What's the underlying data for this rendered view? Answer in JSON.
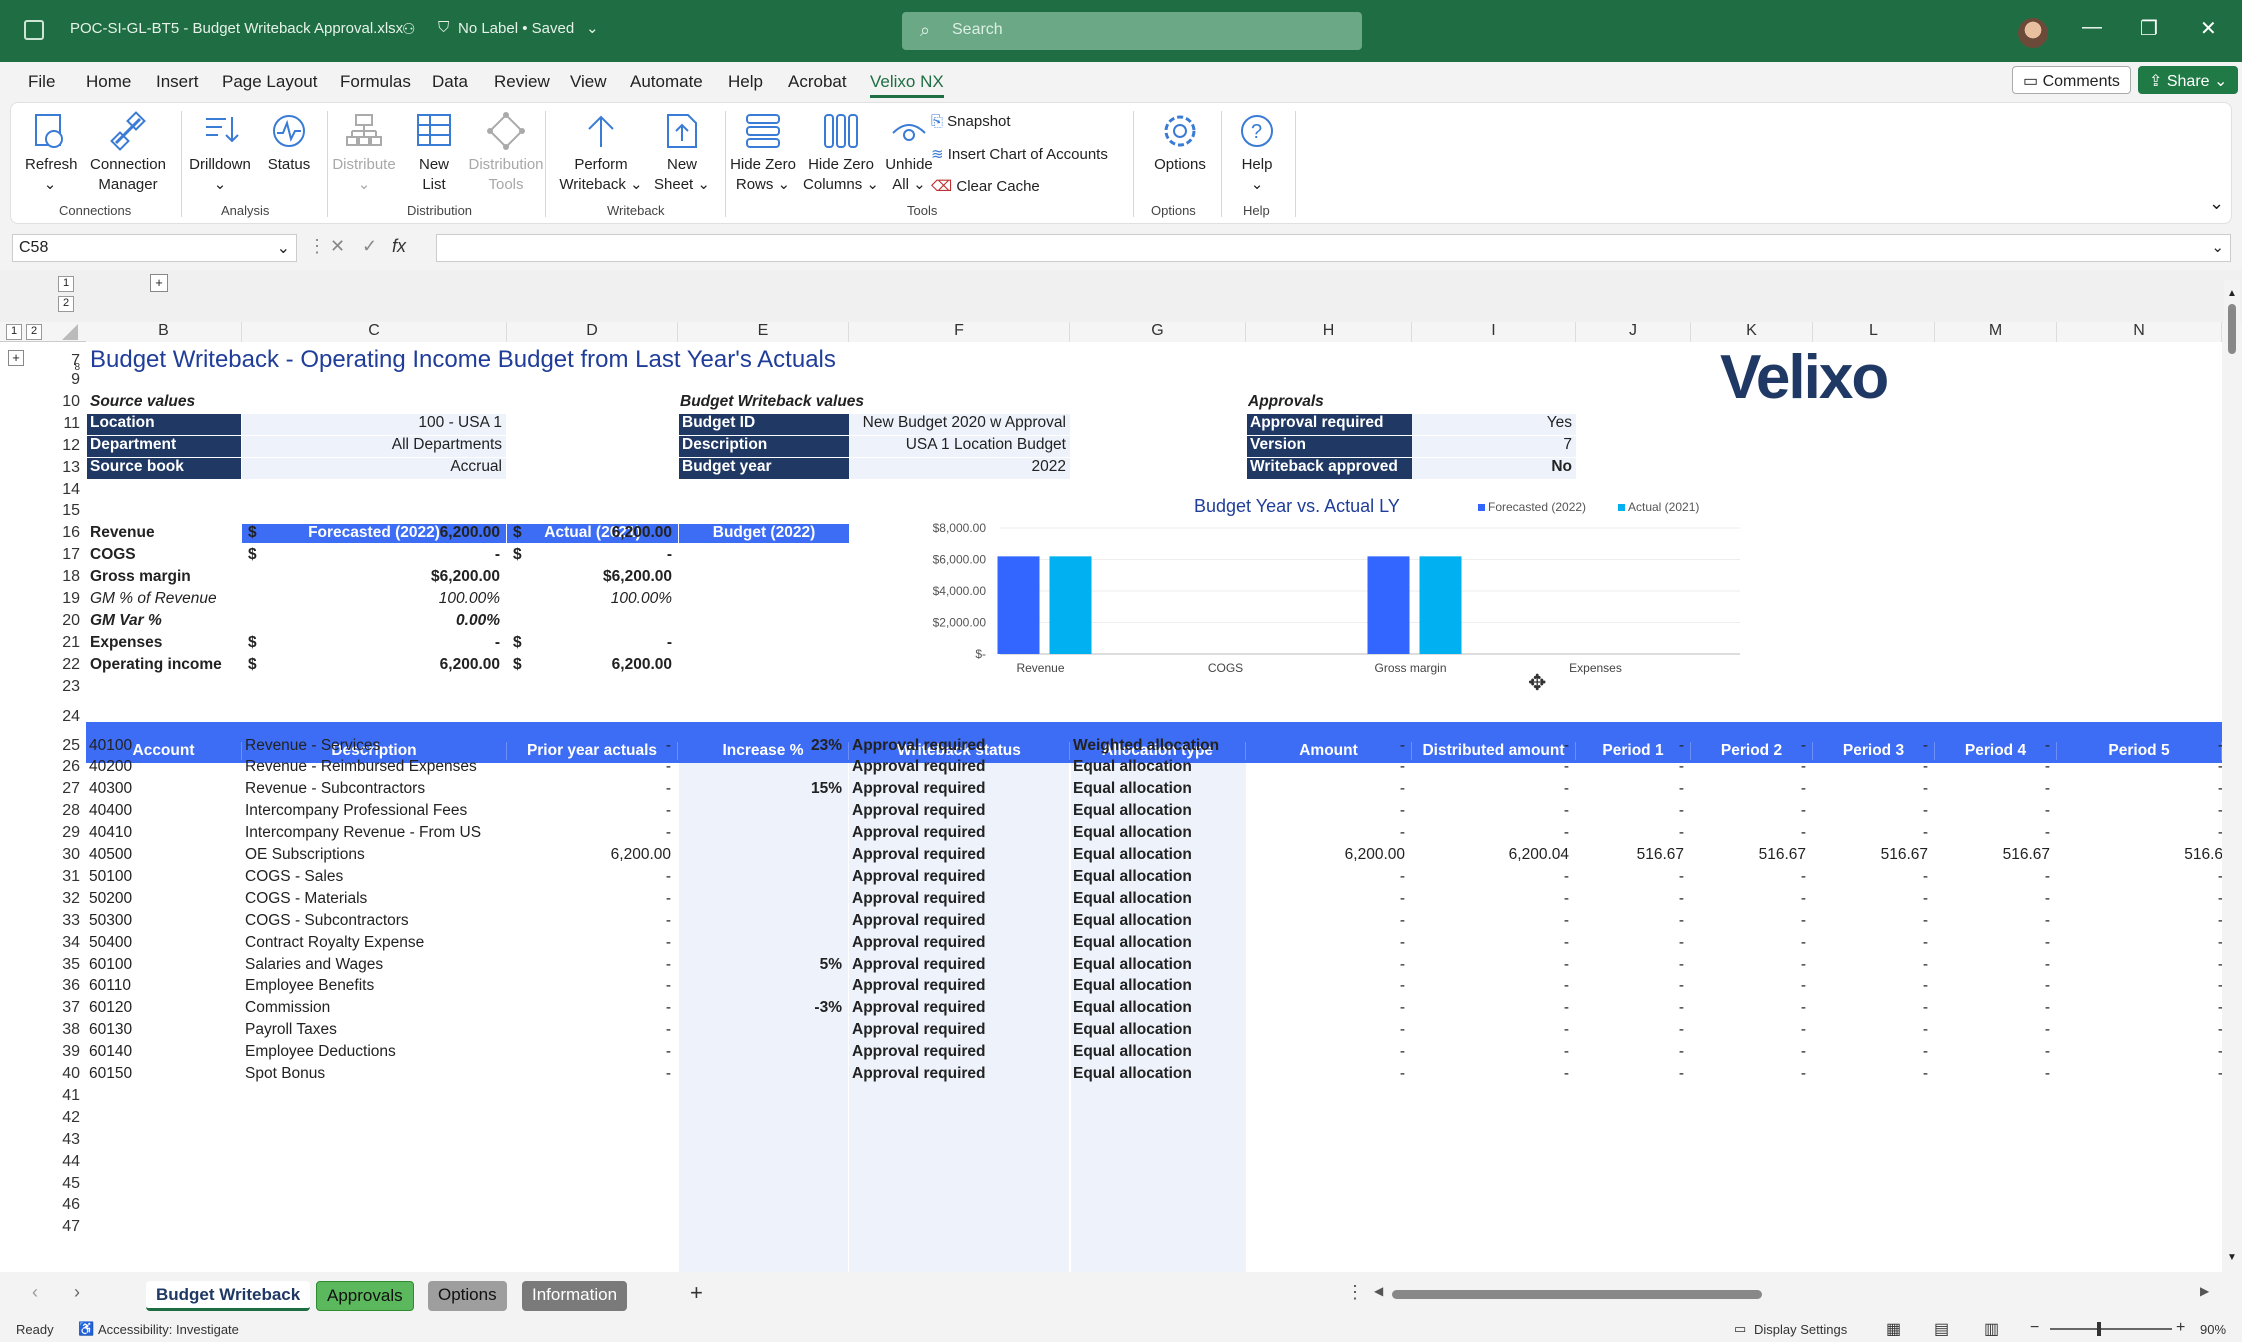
{
  "titlebar": {
    "file_name": "POC-SI-GL-BT5 - Budget Writeback Approval.xlsx",
    "label_status": "No Label • Saved",
    "search_placeholder": "Search"
  },
  "menu": {
    "items": [
      "File",
      "Home",
      "Insert",
      "Page Layout",
      "Formulas",
      "Data",
      "Review",
      "View",
      "Automate",
      "Help",
      "Acrobat",
      "Velixo NX"
    ],
    "active": "Velixo NX",
    "comments": "Comments",
    "share": "Share"
  },
  "ribbon": {
    "refresh": "Refresh",
    "connection_manager": [
      "Connection",
      "Manager"
    ],
    "drilldown": "Drilldown",
    "status": "Status",
    "distribute": "Distribute",
    "new_list": [
      "New",
      "List"
    ],
    "distribution_tools": [
      "Distribution",
      "Tools"
    ],
    "perform_writeback": [
      "Perform",
      "Writeback"
    ],
    "new_sheet": [
      "New",
      "Sheet"
    ],
    "hide_zero_rows": [
      "Hide Zero",
      "Rows"
    ],
    "hide_zero_columns": [
      "Hide Zero",
      "Columns"
    ],
    "unhide_all": [
      "Unhide",
      "All"
    ],
    "snapshot": "Snapshot",
    "insert_coa": "Insert Chart of Accounts",
    "clear_cache": "Clear Cache",
    "options": "Options",
    "help": "Help",
    "groups": [
      "Connections",
      "Analysis",
      "Distribution",
      "Writeback",
      "Tools",
      "Options",
      "Help"
    ]
  },
  "formula_bar": {
    "name_box": "C58",
    "fx": "fx",
    "formula": ""
  },
  "columns": [
    "B",
    "C",
    "D",
    "E",
    "F",
    "G",
    "H",
    "I",
    "J",
    "K",
    "L",
    "M",
    "N"
  ],
  "outline_levels": [
    "1",
    "2"
  ],
  "sheet": {
    "title": "Budget Writeback - Operating Income Budget from Last Year's Actuals",
    "logo": "Velixo",
    "source": {
      "heading": "Source values",
      "rows": [
        {
          "label": "Location",
          "value": "100 - USA 1"
        },
        {
          "label": "Department",
          "value": "All Departments"
        },
        {
          "label": "Source book",
          "value": "Accrual"
        }
      ]
    },
    "writeback": {
      "heading": "Budget Writeback values",
      "rows": [
        {
          "label": "Budget ID",
          "value": "New Budget 2020 w Approval"
        },
        {
          "label": "Description",
          "value": "USA 1 Location Budget"
        },
        {
          "label": "Budget year",
          "value": "2022"
        }
      ]
    },
    "approvals": {
      "heading": "Approvals",
      "rows": [
        {
          "label": "Approval required",
          "value": "Yes"
        },
        {
          "label": "Version",
          "value": "7"
        },
        {
          "label": "Writeback approved",
          "value": "No"
        }
      ]
    },
    "summary": {
      "headers": [
        "Forecasted (2022)",
        "Actual (2021)",
        "Budget (2022)"
      ],
      "rows": [
        {
          "label": "Revenue",
          "d1": "$",
          "v1": "6,200.00",
          "d2": "$",
          "v2": "6,200.00",
          "style": "b"
        },
        {
          "label": "COGS",
          "d1": "$",
          "v1": "-",
          "d2": "$",
          "v2": "-",
          "style": "b"
        },
        {
          "label": "Gross margin",
          "d1": "",
          "v1": "$6,200.00",
          "d2": "",
          "v2": "$6,200.00",
          "style": "b"
        },
        {
          "label": "GM % of Revenue",
          "d1": "",
          "v1": "100.00%",
          "d2": "",
          "v2": "100.00%",
          "style": "i"
        },
        {
          "label": "GM Var %",
          "d1": "",
          "v1": "0.00%",
          "d2": "",
          "v2": "",
          "style": "bi"
        },
        {
          "label": "Expenses",
          "d1": "$",
          "v1": "-",
          "d2": "$",
          "v2": "-",
          "style": "b"
        },
        {
          "label": "Operating income",
          "d1": "$",
          "v1": "6,200.00",
          "d2": "$",
          "v2": "6,200.00",
          "style": "b"
        }
      ]
    },
    "table": {
      "headers": [
        "Account",
        "Description",
        "Prior year actuals",
        "Increase %",
        "Writeback status",
        "Allocation type",
        "Amount",
        "Distributed amount",
        "Period 1",
        "Period 2",
        "Period 3",
        "Period 4",
        "Period 5"
      ],
      "rows": [
        [
          "40100",
          "Revenue - Services",
          "-",
          "23%",
          "Approval required",
          "Weighted allocation",
          "-",
          "-",
          "-",
          "-",
          "-",
          "-",
          "-"
        ],
        [
          "40200",
          "Revenue - Reimbursed Expenses",
          "-",
          "",
          "Approval required",
          "Equal allocation",
          "-",
          "-",
          "-",
          "-",
          "-",
          "-",
          "-"
        ],
        [
          "40300",
          "Revenue - Subcontractors",
          "-",
          "15%",
          "Approval required",
          "Equal allocation",
          "-",
          "-",
          "-",
          "-",
          "-",
          "-",
          "-"
        ],
        [
          "40400",
          "Intercompany Professional Fees",
          "-",
          "",
          "Approval required",
          "Equal allocation",
          "-",
          "-",
          "-",
          "-",
          "-",
          "-",
          "-"
        ],
        [
          "40410",
          "Intercompany Revenue - From US",
          "-",
          "",
          "Approval required",
          "Equal allocation",
          "-",
          "-",
          "-",
          "-",
          "-",
          "-",
          "-"
        ],
        [
          "40500",
          "OE Subscriptions",
          "6,200.00",
          "",
          "Approval required",
          "Equal allocation",
          "6,200.00",
          "6,200.04",
          "516.67",
          "516.67",
          "516.67",
          "516.67",
          "516.6"
        ],
        [
          "50100",
          "COGS - Sales",
          "-",
          "",
          "Approval required",
          "Equal allocation",
          "-",
          "-",
          "-",
          "-",
          "-",
          "-",
          "-"
        ],
        [
          "50200",
          "COGS - Materials",
          "-",
          "",
          "Approval required",
          "Equal allocation",
          "-",
          "-",
          "-",
          "-",
          "-",
          "-",
          "-"
        ],
        [
          "50300",
          "COGS - Subcontractors",
          "-",
          "",
          "Approval required",
          "Equal allocation",
          "-",
          "-",
          "-",
          "-",
          "-",
          "-",
          "-"
        ],
        [
          "50400",
          "Contract Royalty Expense",
          "-",
          "",
          "Approval required",
          "Equal allocation",
          "-",
          "-",
          "-",
          "-",
          "-",
          "-",
          "-"
        ],
        [
          "60100",
          "Salaries and Wages",
          "-",
          "5%",
          "Approval required",
          "Equal allocation",
          "-",
          "-",
          "-",
          "-",
          "-",
          "-",
          "-"
        ],
        [
          "60110",
          "Employee Benefits",
          "-",
          "",
          "Approval required",
          "Equal allocation",
          "-",
          "-",
          "-",
          "-",
          "-",
          "-",
          "-"
        ],
        [
          "60120",
          "Commission",
          "-",
          "-3%",
          "Approval required",
          "Equal allocation",
          "-",
          "-",
          "-",
          "-",
          "-",
          "-",
          "-"
        ],
        [
          "60130",
          "Payroll Taxes",
          "-",
          "",
          "Approval required",
          "Equal allocation",
          "-",
          "-",
          "-",
          "-",
          "-",
          "-",
          "-"
        ],
        [
          "60140",
          "Employee Deductions",
          "-",
          "",
          "Approval required",
          "Equal allocation",
          "-",
          "-",
          "-",
          "-",
          "-",
          "-",
          "-"
        ],
        [
          "60150",
          "Spot Bonus",
          "-",
          "",
          "Approval required",
          "Equal allocation",
          "-",
          "-",
          "-",
          "-",
          "-",
          "-",
          "-"
        ]
      ]
    },
    "row_numbers": [
      "7",
      "8",
      "9",
      "10",
      "11",
      "12",
      "13",
      "14",
      "15",
      "16",
      "17",
      "18",
      "19",
      "20",
      "21",
      "22",
      "23",
      "24",
      "25",
      "26",
      "27",
      "28",
      "29",
      "30",
      "31",
      "32",
      "33",
      "34",
      "35",
      "36",
      "37",
      "38",
      "39",
      "40",
      "41",
      "42",
      "43",
      "44",
      "45",
      "46",
      "47"
    ]
  },
  "chart_data": {
    "type": "bar",
    "title": "Budget Year vs. Actual LY",
    "categories": [
      "Revenue",
      "COGS",
      "Gross margin",
      "Expenses"
    ],
    "series": [
      {
        "name": "Forecasted (2022)",
        "values": [
          6200,
          0,
          6200,
          0
        ],
        "color": "#3366ff"
      },
      {
        "name": "Actual (2021)",
        "values": [
          6200,
          0,
          6200,
          0
        ],
        "color": "#00b0f0"
      }
    ],
    "ylim": [
      0,
      8000
    ],
    "yticks": [
      "$8,000.00",
      "$6,000.00",
      "$4,000.00",
      "$2,000.00",
      "$-"
    ],
    "legend": "top-right"
  },
  "tabs": [
    {
      "label": "Budget Writeback",
      "active": true,
      "color": "#f3f3f3"
    },
    {
      "label": "Approvals",
      "active": false,
      "color": "#5cb85c"
    },
    {
      "label": "Options",
      "active": false,
      "color": "#9e9e9e"
    },
    {
      "label": "Information",
      "active": false,
      "color": "#7a7a7a"
    }
  ],
  "statusbar": {
    "ready": "Ready",
    "accessibility": "Accessibility: Investigate",
    "display_settings": "Display Settings",
    "zoom": "90%"
  }
}
